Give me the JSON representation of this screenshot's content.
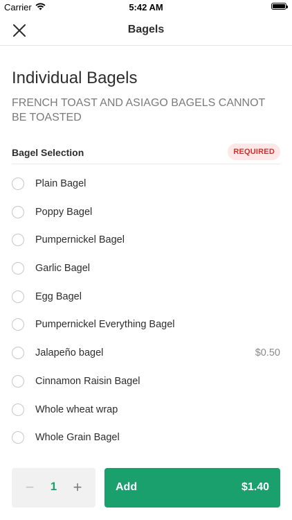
{
  "status_bar": {
    "carrier": "Carrier",
    "time": "5:42 AM"
  },
  "nav": {
    "title": "Bagels"
  },
  "item": {
    "title": "Individual Bagels",
    "description": "FRENCH TOAST AND ASIAGO BAGELS CANNOT BE TOASTED"
  },
  "section": {
    "title": "Bagel Selection",
    "badge": "REQUIRED",
    "badge_color": "#d0312d",
    "options": [
      {
        "label": "Plain Bagel",
        "price": ""
      },
      {
        "label": "Poppy Bagel",
        "price": ""
      },
      {
        "label": "Pumpernickel Bagel",
        "price": ""
      },
      {
        "label": "Garlic Bagel",
        "price": ""
      },
      {
        "label": "Egg Bagel",
        "price": ""
      },
      {
        "label": "Pumpernickel Everything Bagel",
        "price": ""
      },
      {
        "label": "Jalapeño bagel",
        "price": "$0.50"
      },
      {
        "label": "Cinnamon Raisin Bagel",
        "price": ""
      },
      {
        "label": "Whole wheat wrap",
        "price": ""
      },
      {
        "label": "Whole Grain Bagel",
        "price": ""
      }
    ]
  },
  "footer": {
    "quantity": "1",
    "minus_symbol": "−",
    "plus_symbol": "+",
    "add_label": "Add",
    "add_price": "$1.40",
    "accent_color": "#1aa06d"
  }
}
